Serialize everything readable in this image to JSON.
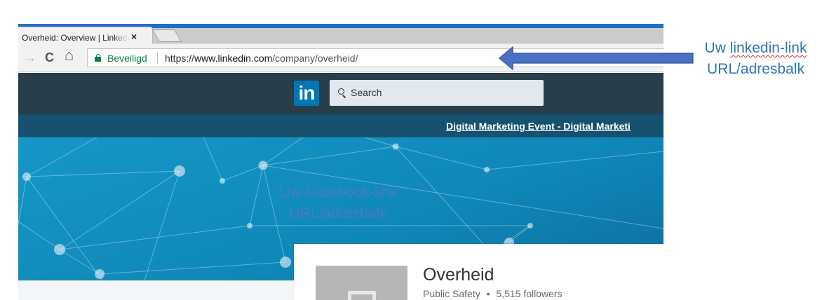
{
  "browser": {
    "tab_title": "Overheid: Overview | LinkedIn",
    "tab_close": "×",
    "favicon_glyph": "i",
    "nav": {
      "back": "←",
      "forward": "→",
      "reload": "C",
      "home": "⌂"
    },
    "secure_label": "Beveiligd",
    "url_scheme": "https://",
    "url_host": "www.linkedin.com",
    "url_path": "/company/overheid/"
  },
  "linkedin": {
    "logo_text": "in",
    "search_placeholder": "Search",
    "banner_link": "Digital Marketing Event - Digital Marketi",
    "company": {
      "name": "Overheid",
      "industry": "Public Safety",
      "separator": "•",
      "followers": "5,515 followers"
    }
  },
  "annotations": {
    "overlay_line1": "Uw Facebook-link",
    "overlay_line2": "URL/adresbalk",
    "callout_word1": "Uw",
    "callout_word2": "linkedin-link",
    "callout_line2": "URL/adresbalk",
    "arrow_color": "#4a72c4"
  },
  "colors": {
    "linkedin_blue": "#0077b5",
    "header_dark": "#283e4a",
    "secure_green": "#0b8043",
    "callout_blue": "#2e75b6"
  }
}
